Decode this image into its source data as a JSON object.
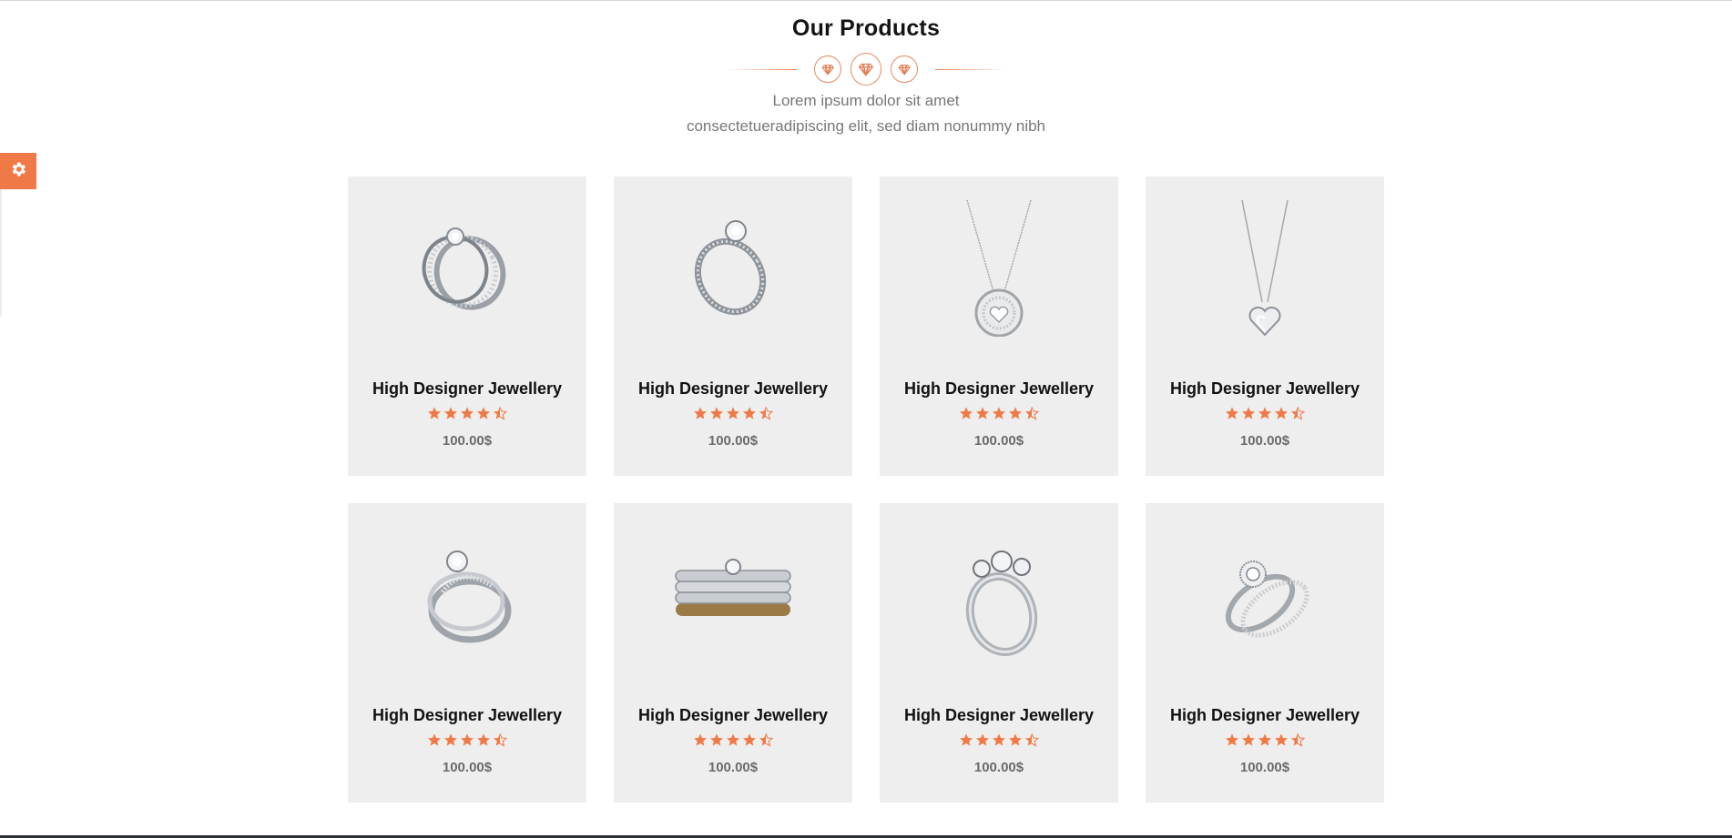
{
  "section": {
    "title": "Our Products",
    "subtitle_line1": "Lorem ipsum dolor sit amet",
    "subtitle_line2": "consectetueradipiscing elit, sed diam nonummy nibh"
  },
  "colors": {
    "accent": "#f07a47",
    "card_background": "#eeeeee",
    "price_text": "#6b6b6b"
  },
  "icons": {
    "settings": "gear-icon",
    "divider": "diamond-icon",
    "rating": "star-icon"
  },
  "products": [
    {
      "name": "High Designer Jewellery",
      "rating": 4.5,
      "price": "100.00$",
      "image": "ring-diamond-band-set"
    },
    {
      "name": "High Designer Jewellery",
      "rating": 4.5,
      "price": "100.00$",
      "image": "ring-solitaire-pave"
    },
    {
      "name": "High Designer Jewellery",
      "rating": 4.5,
      "price": "100.00$",
      "image": "necklace-heart-disc"
    },
    {
      "name": "High Designer Jewellery",
      "rating": 4.5,
      "price": "100.00$",
      "image": "necklace-heart-pendant"
    },
    {
      "name": "High Designer Jewellery",
      "rating": 4.5,
      "price": "100.00$",
      "image": "ring-swirl-set"
    },
    {
      "name": "High Designer Jewellery",
      "rating": 4.5,
      "price": "100.00$",
      "image": "ring-gold-triple-band"
    },
    {
      "name": "High Designer Jewellery",
      "rating": 4.5,
      "price": "100.00$",
      "image": "ring-three-stone"
    },
    {
      "name": "High Designer Jewellery",
      "rating": 4.5,
      "price": "100.00$",
      "image": "ring-halo-bridal-set"
    }
  ]
}
